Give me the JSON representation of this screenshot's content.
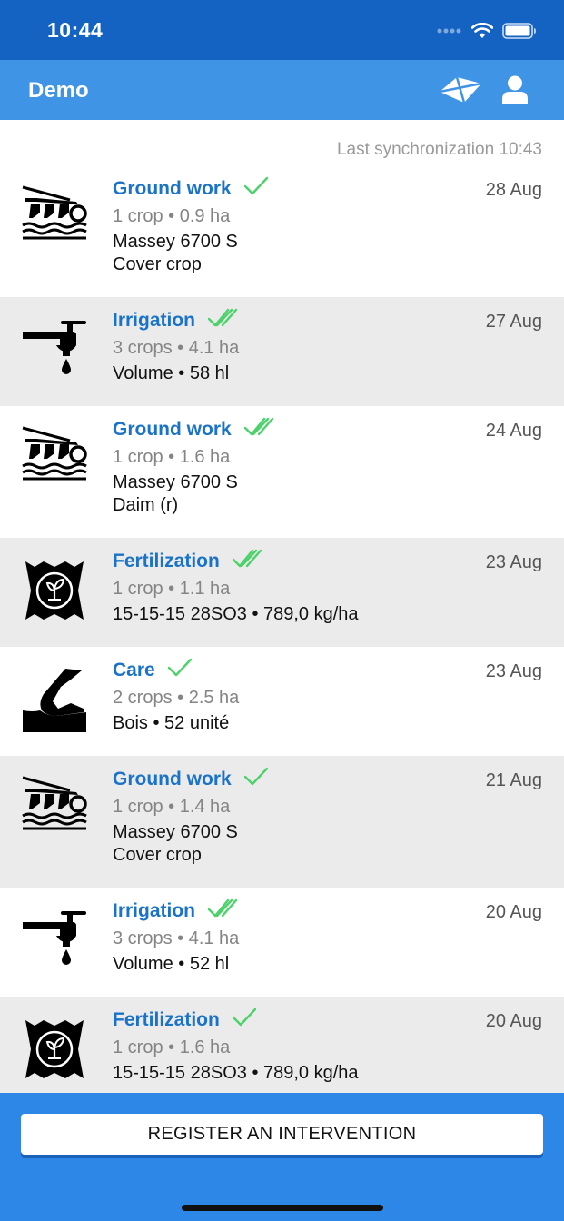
{
  "status": {
    "time": "10:44"
  },
  "header": {
    "title": "Demo",
    "map_icon": "map-icon",
    "user_icon": "user-icon"
  },
  "sync_text": "Last synchronization 10:43",
  "interventions": [
    {
      "type": "Ground work",
      "icon": "plough-icon",
      "check": "single",
      "sub": "1 crop • 0.9 ha",
      "line1": "Massey 6700 S",
      "line2": "Cover crop",
      "date": "28 Aug"
    },
    {
      "type": "Irrigation",
      "icon": "tap-icon",
      "check": "double",
      "sub": "3 crops • 4.1 ha",
      "line1": "Volume • 58 hl",
      "line2": "",
      "date": "27 Aug"
    },
    {
      "type": "Ground work",
      "icon": "plough-icon",
      "check": "double",
      "sub": "1 crop • 1.6 ha",
      "line1": "Massey 6700 S",
      "line2": "Daim (r)",
      "date": "24 Aug"
    },
    {
      "type": "Fertilization",
      "icon": "fertilizer-bag-icon",
      "check": "double",
      "sub": "1 crop • 1.1 ha",
      "line1": "15-15-15 28SO3 • 789,0 kg/ha",
      "line2": "",
      "date": "23 Aug"
    },
    {
      "type": "Care",
      "icon": "hand-icon",
      "check": "single",
      "sub": "2 crops • 2.5 ha",
      "line1": "Bois • 52 unité",
      "line2": "",
      "date": "23 Aug"
    },
    {
      "type": "Ground work",
      "icon": "plough-icon",
      "check": "single",
      "sub": "1 crop • 1.4 ha",
      "line1": "Massey 6700 S",
      "line2": "Cover crop",
      "date": "21 Aug"
    },
    {
      "type": "Irrigation",
      "icon": "tap-icon",
      "check": "double",
      "sub": "3 crops • 4.1 ha",
      "line1": "Volume • 52 hl",
      "line2": "",
      "date": "20 Aug"
    },
    {
      "type": "Fertilization",
      "icon": "fertilizer-bag-icon",
      "check": "single",
      "sub": "1 crop • 1.6 ha",
      "line1": "15-15-15 28SO3 • 789,0 kg/ha",
      "line2": "",
      "date": "20 Aug"
    }
  ],
  "register_button": "REGISTER AN INTERVENTION",
  "colors": {
    "accent": "#1b73c9",
    "check": "#4cd26a",
    "nav": "#3f94e6",
    "status": "#1463c3",
    "bottom": "#2c87e6"
  }
}
